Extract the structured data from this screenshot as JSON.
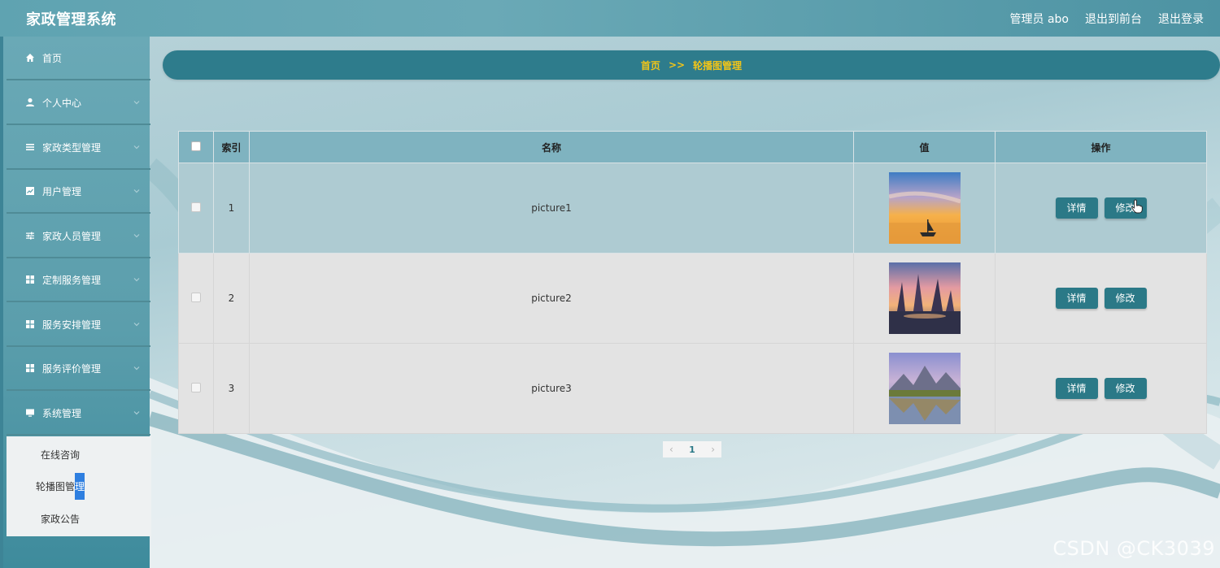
{
  "header": {
    "app_title": "家政管理系统",
    "links": [
      "管理员 abo",
      "退出到前台",
      "退出登录"
    ]
  },
  "sidebar": {
    "items": [
      {
        "label": "首页",
        "icon": "home-icon",
        "has_arrow": false
      },
      {
        "label": "个人中心",
        "icon": "user-icon",
        "has_arrow": true
      },
      {
        "label": "家政类型管理",
        "icon": "list-icon",
        "has_arrow": true
      },
      {
        "label": "用户管理",
        "icon": "chart-icon",
        "has_arrow": true
      },
      {
        "label": "家政人员管理",
        "icon": "sliders-icon",
        "has_arrow": true
      },
      {
        "label": "定制服务管理",
        "icon": "grid-icon",
        "has_arrow": true
      },
      {
        "label": "服务安排管理",
        "icon": "grid-icon",
        "has_arrow": true
      },
      {
        "label": "服务评价管理",
        "icon": "grid-icon",
        "has_arrow": true
      },
      {
        "label": "系统管理",
        "icon": "monitor-icon",
        "has_arrow": true
      }
    ],
    "submenu": [
      {
        "label": "在线咨询",
        "active": false
      },
      {
        "label_pre": "轮播图管",
        "label_hl": "理",
        "active": true
      },
      {
        "label": "家政公告",
        "active": false
      }
    ]
  },
  "breadcrumb": {
    "home": "首页",
    "separator": ">>",
    "current": "轮播图管理"
  },
  "table": {
    "columns": [
      "索引",
      "名称",
      "值",
      "操作"
    ],
    "rows": [
      {
        "index": "1",
        "name": "picture1",
        "image": "sunset-boat-image",
        "detail": "详情",
        "edit": "修改"
      },
      {
        "index": "2",
        "name": "picture2",
        "image": "fantasy-rocks-image",
        "detail": "详情",
        "edit": "修改"
      },
      {
        "index": "3",
        "name": "picture3",
        "image": "mountain-lake-image",
        "detail": "详情",
        "edit": "修改"
      }
    ]
  },
  "pagination": {
    "current_page": "1"
  },
  "watermark": "CSDN @CK3039",
  "colors": {
    "accent": "#2b7987",
    "breadcrumb_text": "#f0c419",
    "active_highlight": "#2e7fe0"
  }
}
